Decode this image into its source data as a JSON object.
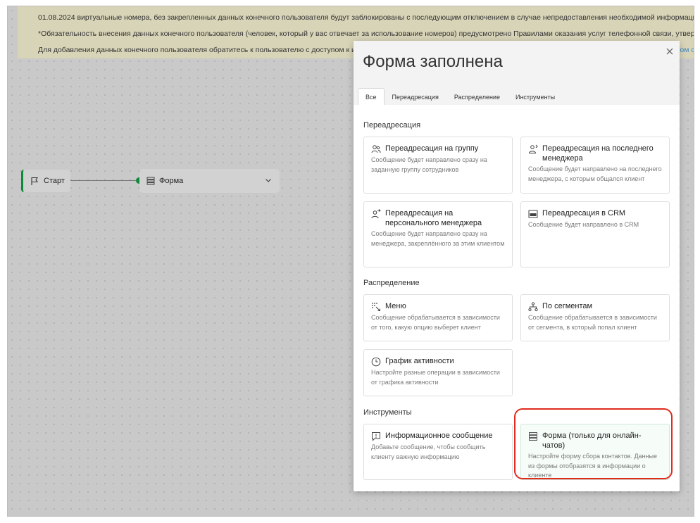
{
  "notice": {
    "line1": "01.08.2024 виртуальные номера, без закрепленных данных конечного пользователя будут заблокированы с последующим отключением в случае непредоставления необходимой информации.",
    "line2": "*Обязательность внесения данных конечного пользователя (человек, который у вас отвечает за использование номеров) предусмотрено Правилами оказания услуг телефонной связи, утвержденных Поста",
    "line3": "Для добавления данных конечного пользователя обратитесь к пользователю с доступом к интерф",
    "link_fragment": "ком с"
  },
  "canvas": {
    "start_label": "Старт",
    "form_label": "Форма"
  },
  "modal": {
    "title": "Форма заполнена",
    "tabs": [
      "Все",
      "Переадресация",
      "Распределение",
      "Инструменты"
    ],
    "sections": {
      "redirect": {
        "title": "Переадресация",
        "cards": [
          {
            "title": "Переадресация на группу",
            "desc": "Сообщение будет направлено сразу на заданную группу сотрудников",
            "icon": "group-icon"
          },
          {
            "title": "Переадресация на последнего менеджера",
            "desc": "Сообщение будет направлено на последнего менеджера, с которым общался клиент",
            "icon": "last-manager-icon"
          },
          {
            "title": "Переадресация на персонального менеджера",
            "desc": "Сообщение будет направлено сразу на менеджера, закреплённого за этим клиентом",
            "icon": "personal-manager-icon"
          },
          {
            "title": "Переадресация в CRM",
            "desc": "Сообщение будет направлено в CRM",
            "icon": "crm-icon"
          }
        ]
      },
      "distribution": {
        "title": "Распределение",
        "cards": [
          {
            "title": "Меню",
            "desc": "Сообщение обрабатывается в зависимости от того, какую опцию выберет клиент",
            "icon": "menu-icon"
          },
          {
            "title": "По сегментам",
            "desc": "Сообщение обрабатывается в зависимости от сегмента, в который попал клиент",
            "icon": "segments-icon"
          },
          {
            "title": "График активности",
            "desc": "Настройте разные операции в зависимости от графика активности",
            "icon": "clock-icon"
          }
        ]
      },
      "tools": {
        "title": "Инструменты",
        "cards": [
          {
            "title": "Информационное сообщение",
            "desc": "Добавьте сообщение, чтобы сообщить клиенту важную информацию",
            "icon": "info-message-icon"
          },
          {
            "title": "Форма (только для онлайн-чатов)",
            "desc": "Настройте форму сбора контактов. Данные из формы отобразятся в информации о клиенте",
            "icon": "form-icon"
          }
        ]
      }
    }
  },
  "colors": {
    "accent_green": "#0d8a3c",
    "highlight_red": "#e02b1e",
    "notice_bg": "#d8d4b8"
  }
}
